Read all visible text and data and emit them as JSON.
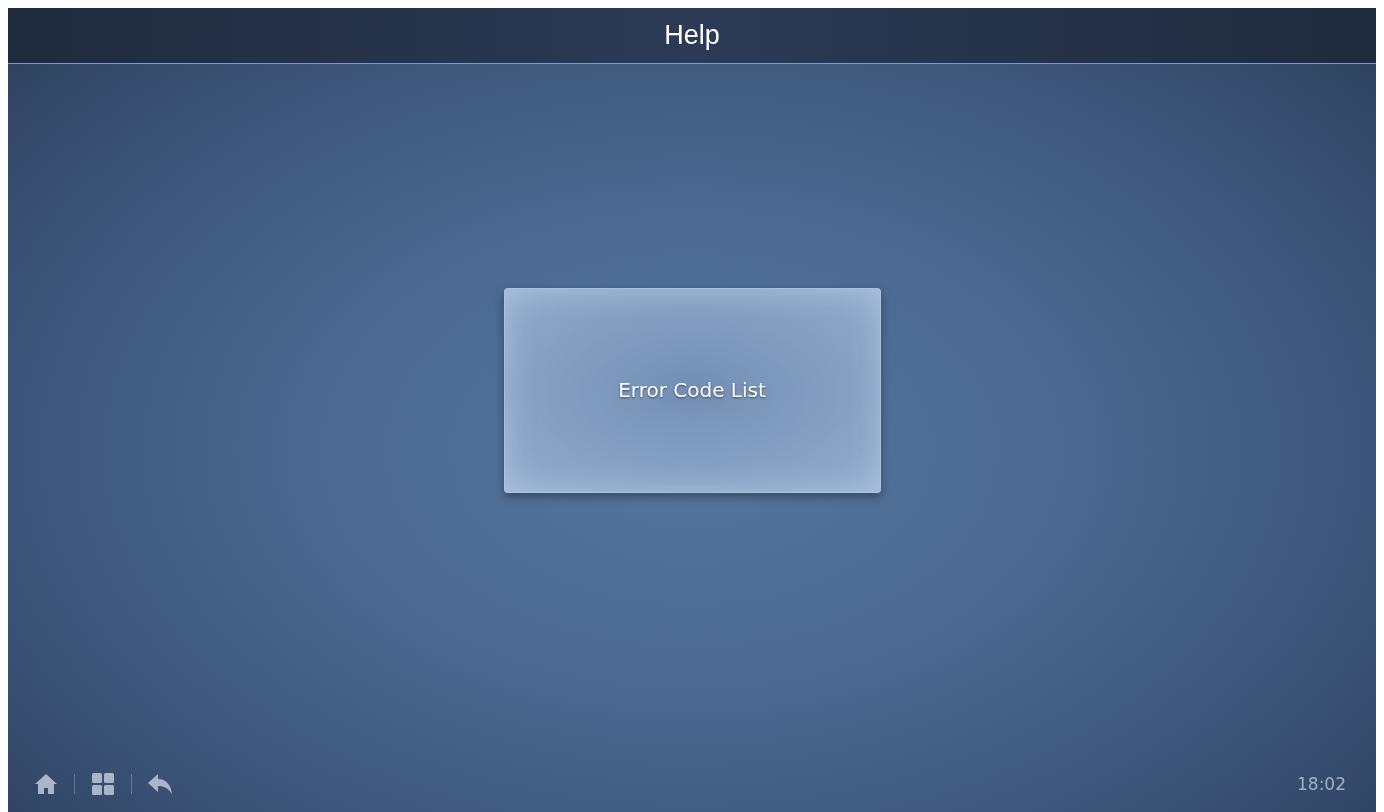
{
  "header": {
    "title": "Help"
  },
  "menu_buttons": [
    {
      "label": "Error Code List"
    }
  ],
  "footer": {
    "nav_icons": [
      {
        "kind": "home"
      },
      {
        "kind": "grid"
      },
      {
        "kind": "back"
      }
    ],
    "time": "18:02"
  }
}
